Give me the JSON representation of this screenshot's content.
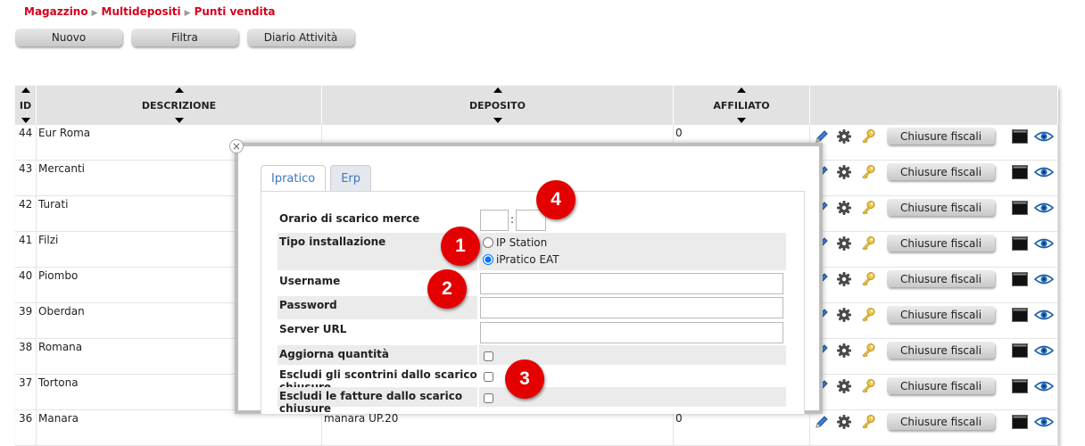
{
  "breadcrumb": [
    "Magazzino",
    "Multidepositi",
    "Punti vendita"
  ],
  "toolbar": {
    "nuovo": "Nuovo",
    "filtra": "Filtra",
    "diario": "Diario Attività"
  },
  "table": {
    "headers": {
      "id": "ID",
      "descrizione": "DESCRIZIONE",
      "deposito": "DEPOSITO",
      "affiliato": "AFFILIATO"
    },
    "rows": [
      {
        "id": "44",
        "desc": "Eur Roma",
        "deposito": "",
        "affiliato": "0"
      },
      {
        "id": "43",
        "desc": "Mercanti",
        "deposito": "",
        "affiliato": ""
      },
      {
        "id": "42",
        "desc": "Turati",
        "deposito": "",
        "affiliato": ""
      },
      {
        "id": "41",
        "desc": "Filzi",
        "deposito": "",
        "affiliato": ""
      },
      {
        "id": "40",
        "desc": "Piombo",
        "deposito": "",
        "affiliato": ""
      },
      {
        "id": "39",
        "desc": "Oberdan",
        "deposito": "",
        "affiliato": ""
      },
      {
        "id": "38",
        "desc": "Romana",
        "deposito": "",
        "affiliato": ""
      },
      {
        "id": "37",
        "desc": "Tortona",
        "deposito": "",
        "affiliato": ""
      },
      {
        "id": "36",
        "desc": "Manara",
        "deposito": "manara UP.20",
        "affiliato": "0"
      }
    ],
    "fiscal_label": "Chiusure fiscali"
  },
  "modal": {
    "close": "×",
    "tabs": [
      "Ipratico",
      "Erp"
    ],
    "fields": {
      "orario": "Orario di scarico merce",
      "orario_sep": ":",
      "tipo": "Tipo installazione",
      "opt_ip": "IP Station",
      "opt_eat": "iPratico EAT",
      "username": "Username",
      "password": "Password",
      "server": "Server URL",
      "aggiorna": "Aggiorna quantità",
      "escludi_scontrini": "Escludi gli scontrini dallo scarico chiusure",
      "escludi_fatture": "Escludi le fatture dallo scarico chiusure"
    }
  },
  "badges": [
    "1",
    "2",
    "3",
    "4"
  ],
  "colors": {
    "accent": "#d6001c",
    "badge": "#e40000",
    "tab_text": "#3a77c2"
  }
}
